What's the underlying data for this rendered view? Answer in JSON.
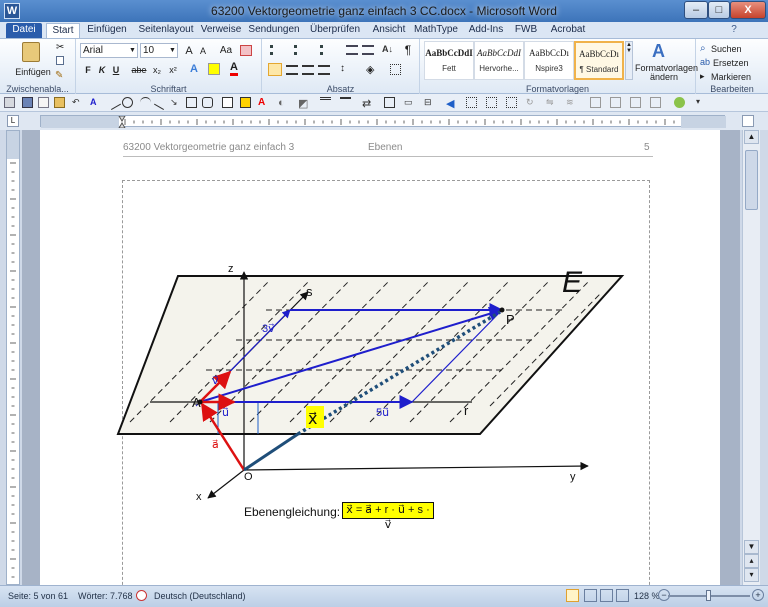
{
  "window": {
    "title": "63200 Vektorgeometrie ganz einfach 3 CC.docx - Microsoft Word",
    "app_icon": "W",
    "minimize": "–",
    "maximize": "□",
    "close": "X"
  },
  "ribbon_tabs": [
    "Datei",
    "Start",
    "Einfügen",
    "Seitenlayout",
    "Verweise",
    "Sendungen",
    "Überprüfen",
    "Ansicht",
    "MathType",
    "Add-Ins",
    "FWB",
    "Acrobat"
  ],
  "active_tab": "Start",
  "ribbon": {
    "clipboard": {
      "paste": "Einfügen",
      "label": "Zwischenabla..."
    },
    "font": {
      "name": "Arial",
      "size": "10",
      "label": "Schriftart",
      "bold": "F",
      "italic": "K",
      "underline": "U",
      "strike": "abe",
      "sub": "x₂",
      "sup": "x²",
      "grow": "A",
      "shrink": "A",
      "case": "Aa"
    },
    "paragraph": {
      "label": "Absatz",
      "pilcrow": "¶"
    },
    "styles": {
      "label": "Formatvorlagen",
      "items": [
        {
          "sample": "AaBbCcDdI",
          "name": "Fett"
        },
        {
          "sample": "AaBbCcDdI",
          "name": "Hervorhe..."
        },
        {
          "sample": "AaBbCcDı",
          "name": "Nspire3"
        },
        {
          "sample": "AaBbCcDı",
          "name": "¶ Standard"
        }
      ],
      "change": "Formatvorlagen",
      "change2": "ändern"
    },
    "editing": {
      "label": "Bearbeiten",
      "find": "Suchen",
      "replace": "Ersetzen",
      "select": "Markieren"
    }
  },
  "document": {
    "header_left": "63200  Vektorgeometrie ganz einfach 3",
    "header_center": "Ebenen",
    "header_right": "5",
    "figure": {
      "plane_label": "E",
      "axis_z": "z",
      "axis_y": "y",
      "axis_x": "x",
      "origin": "O",
      "point_A": "A",
      "point_P": "P",
      "axis_s": "s",
      "axis_r": "r",
      "vec_a": "a⃗",
      "vec_u": "u⃗",
      "vec_v": "v⃗",
      "vec_3v": "3v⃗",
      "vec_5u": "5u⃗",
      "vec_x": "x⃗"
    },
    "equation_label": "Ebenengleichung:",
    "equation": "x⃗ = a⃗ + r · u⃗ + s · v⃗"
  },
  "status": {
    "page": "Seite: 5 von 61",
    "words": "Wörter: 7.768",
    "language": "Deutsch (Deutschland)",
    "zoom": "128 %",
    "zoom_fraction": 0.5
  },
  "colors": {
    "title_bar": "#3d74b9",
    "file_tab": "#2a5cab",
    "plane_fill": "#f4f3ec",
    "blue_vectors": "#1e1ecc",
    "red_vectors": "#dd1111",
    "teal_vector": "#1f4e79",
    "highlight": "#ffff00"
  }
}
